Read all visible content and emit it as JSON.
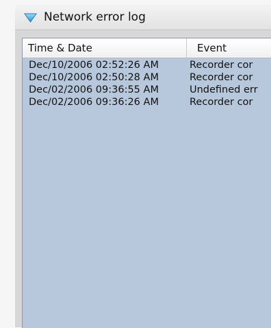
{
  "window": {
    "title": "Network error log",
    "icon": "triangle-down-icon",
    "accent": "#3aa0d8"
  },
  "table": {
    "columns": [
      "Time & Date",
      "Event"
    ],
    "rows": [
      [
        "Dec/10/2006 02:52:26 AM",
        "Recorder cor"
      ],
      [
        "Dec/10/2006 02:50:28 AM",
        "Recorder cor"
      ],
      [
        "Dec/02/2006 09:36:55 AM",
        "Undefined err"
      ],
      [
        "Dec/02/2006 09:36:26 AM",
        "Recorder cor"
      ]
    ],
    "background": "#b7c8dc"
  }
}
